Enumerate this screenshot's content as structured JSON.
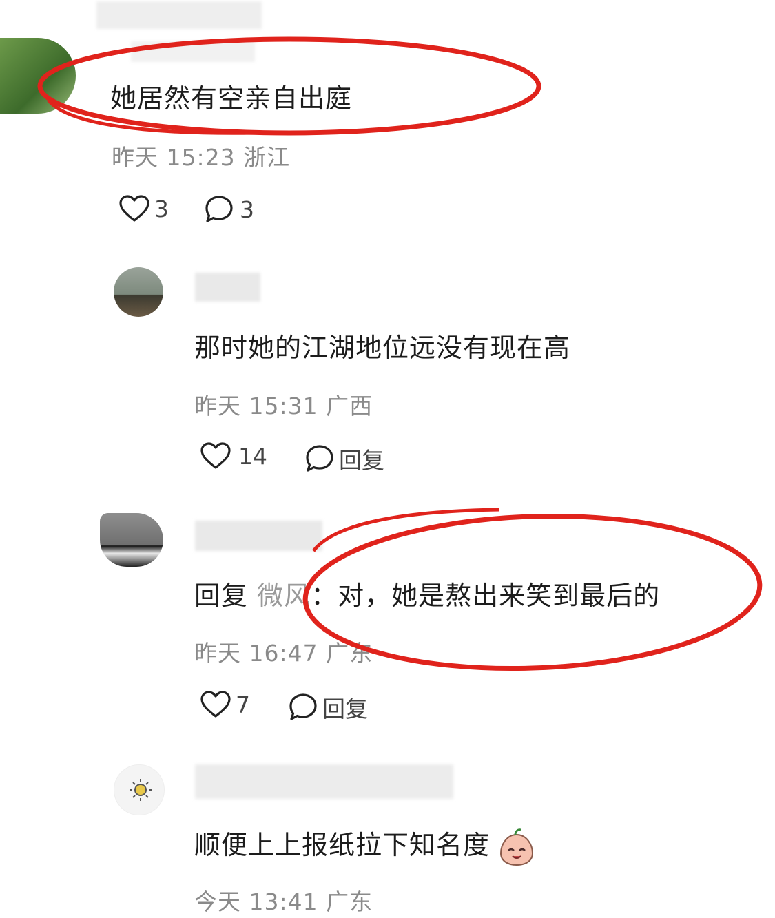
{
  "comments": [
    {
      "text": "她居然有空亲自出庭",
      "date": "昨天",
      "time": "15:23",
      "location": "浙江",
      "likes": "3",
      "replies": "3"
    },
    {
      "text": "那时她的江湖地位远没有现在高",
      "date": "昨天",
      "time": "15:31",
      "location": "广西",
      "likes": "14",
      "reply_label": "回复"
    },
    {
      "reply_prefix": "回复",
      "reply_to": "微风",
      "text": "：对，她是熬出来笑到最后的",
      "date": "昨天",
      "time": "16:47",
      "location": "广东",
      "likes": "7",
      "reply_label": "回复"
    },
    {
      "text": "顺便上上报纸拉下知名度",
      "date": "今天",
      "time": "13:41",
      "location": "广东"
    }
  ],
  "highlight_color": "#e0231c",
  "icons": [
    "heart-icon",
    "comment-bubble-icon",
    "emoji-face-icon",
    "sun-icon"
  ]
}
